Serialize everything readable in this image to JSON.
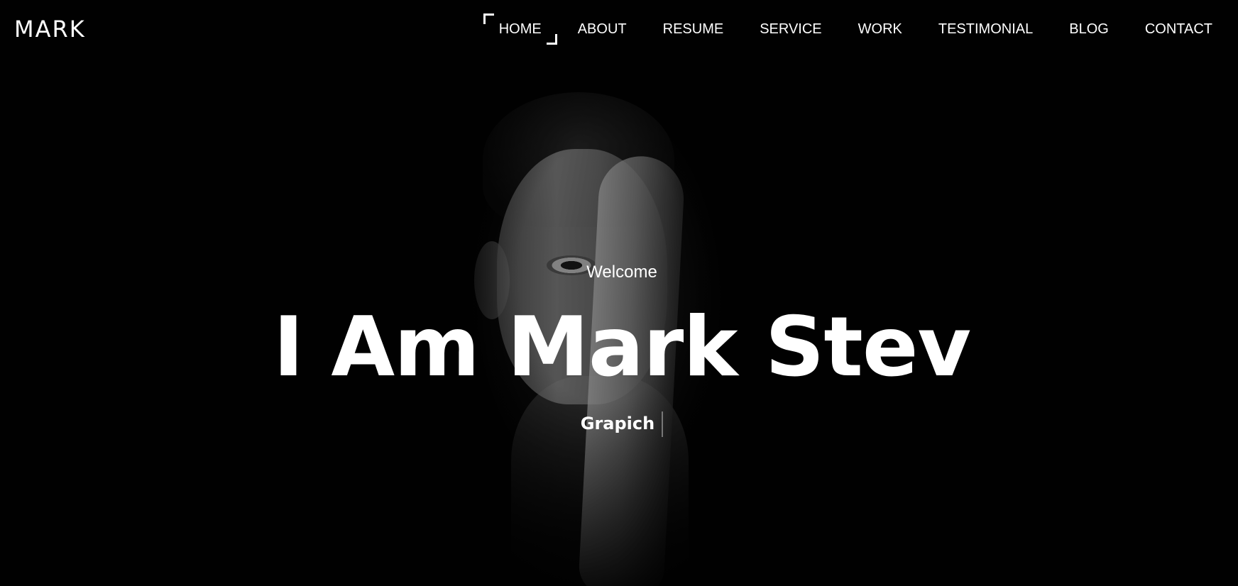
{
  "header": {
    "logo": "MARK",
    "nav": [
      {
        "label": "HOME",
        "active": true
      },
      {
        "label": "ABOUT"
      },
      {
        "label": "RESUME"
      },
      {
        "label": "SERVICE"
      },
      {
        "label": "WORK"
      },
      {
        "label": "TESTIMONIAL"
      },
      {
        "label": "BLOG"
      },
      {
        "label": "CONTACT"
      }
    ]
  },
  "hero": {
    "welcome": "Welcome",
    "title": "I Am Mark Stev",
    "typed_text": "Grapich"
  },
  "colors": {
    "background": "#020202",
    "text": "#ffffff",
    "cursor": "#777777"
  }
}
